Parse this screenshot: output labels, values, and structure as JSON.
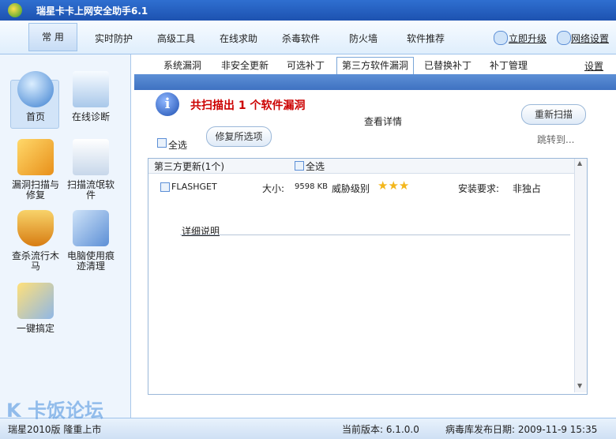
{
  "window": {
    "title": "瑞星卡卡上网安全助手6.1"
  },
  "menu": {
    "items": [
      "常 用",
      "实时防护",
      "高级工具",
      "在线求助",
      "杀毒软件",
      "防火墙",
      "软件推荐"
    ],
    "upgrade": "立即升级",
    "net_settings": "网络设置"
  },
  "sidebar": {
    "items": [
      {
        "label": "首页",
        "icon": "home-icon"
      },
      {
        "label": "在线诊断",
        "icon": "diagnose-icon"
      },
      {
        "label": "漏洞扫描与修复",
        "icon": "vulnerability-icon"
      },
      {
        "label": "扫描流氓软件",
        "icon": "rogue-scan-icon"
      },
      {
        "label": "查杀流行木马",
        "icon": "trojan-icon"
      },
      {
        "label": "电脑使用痕迹清理",
        "icon": "cleanup-icon"
      },
      {
        "label": "一键搞定",
        "icon": "oneclick-icon"
      }
    ]
  },
  "tabs": {
    "items": [
      "系统漏洞",
      "非安全更新",
      "可选补丁",
      "第三方软件漏洞",
      "已替换补丁",
      "补丁管理"
    ],
    "active": "第三方软件漏洞",
    "settings": "设置"
  },
  "scan": {
    "summary": "共扫描出 1 个软件漏洞",
    "details_link": "查看详情",
    "rescan_button": "重新扫描",
    "select_all": "全选",
    "repair_button": "修复所选项",
    "jump_to": "跳转到..."
  },
  "list": {
    "group_header": "第三方更新(1个)",
    "select_all": "全选",
    "row": {
      "name": "FLASHGET",
      "size_label": "大小:",
      "size": "9598 KB",
      "threat_label": "威胁级别",
      "threat_stars": 3,
      "install_label": "安装要求:",
      "install_value": "非独占"
    },
    "details": "详细说明"
  },
  "status": {
    "left": "瑞星2010版 隆重上市",
    "version": "当前版本:  6.1.0.0",
    "virus_date": "病毒库发布日期: 2009-11-9 15:35"
  },
  "watermark": "卡饭论坛",
  "colors": {
    "accent": "#2f6fd0",
    "alert": "#cc0000",
    "stars": "#f3b61b"
  }
}
